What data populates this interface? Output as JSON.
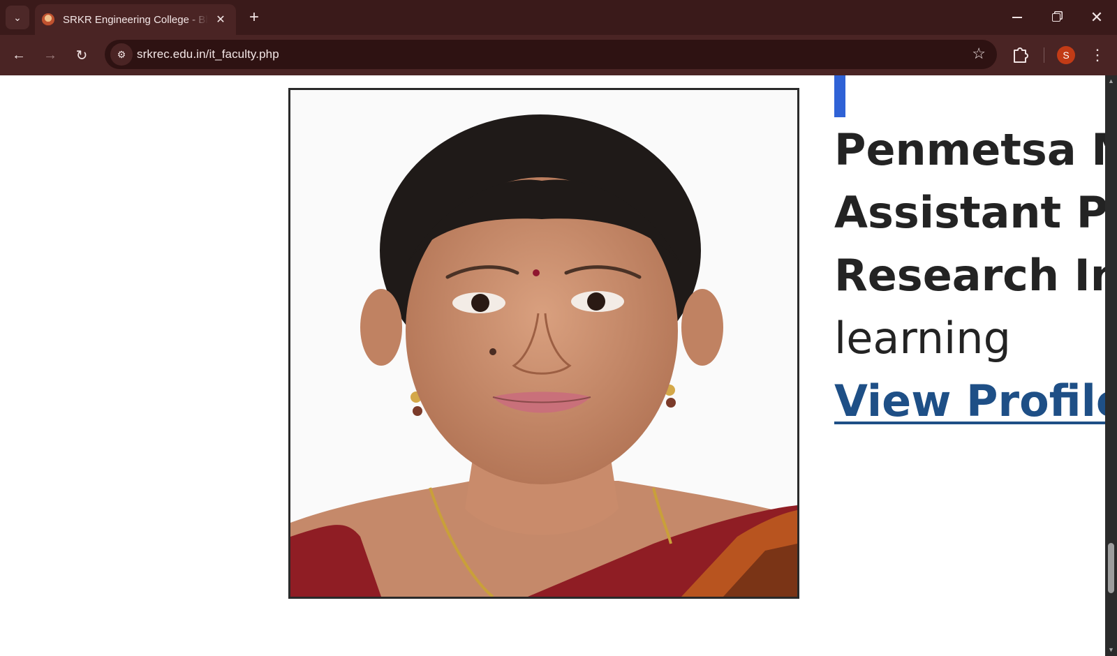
{
  "browser": {
    "tab": {
      "title": "SRKR Engineering College - Bhimavaram",
      "close_glyph": "✕"
    },
    "new_tab_glyph": "+",
    "tab_search_glyph": "⌄",
    "window_close_glyph": "✕",
    "nav": {
      "back_glyph": "←",
      "forward_glyph": "→",
      "reload_glyph": "↻"
    },
    "address_bar": {
      "url": "srkrec.edu.in/it_faculty.php",
      "site_info_glyph": "⚙",
      "bookmark_glyph": "☆"
    },
    "profile_initial": "S",
    "menu_glyph": "⋮",
    "icons": [
      "tab-search-icon",
      "favicon-icon",
      "close-icon",
      "plus-icon",
      "minimize-icon",
      "restore-icon",
      "back-arrow-icon",
      "forward-arrow-icon",
      "reload-icon",
      "site-settings-icon",
      "star-icon",
      "extensions-icon",
      "kebab-menu-icon"
    ]
  },
  "faculty": {
    "name": "Penmetsa Madhuri",
    "designation": "Assistant Professor",
    "research_label": "Research Interests: Machine",
    "research_cont": "learning",
    "view_profile": "View Profile",
    "accent_color": "#2f62d6",
    "link_color": "#1e4f86"
  },
  "scrollbar": {
    "up_glyph": "▲",
    "down_glyph": "▼"
  }
}
